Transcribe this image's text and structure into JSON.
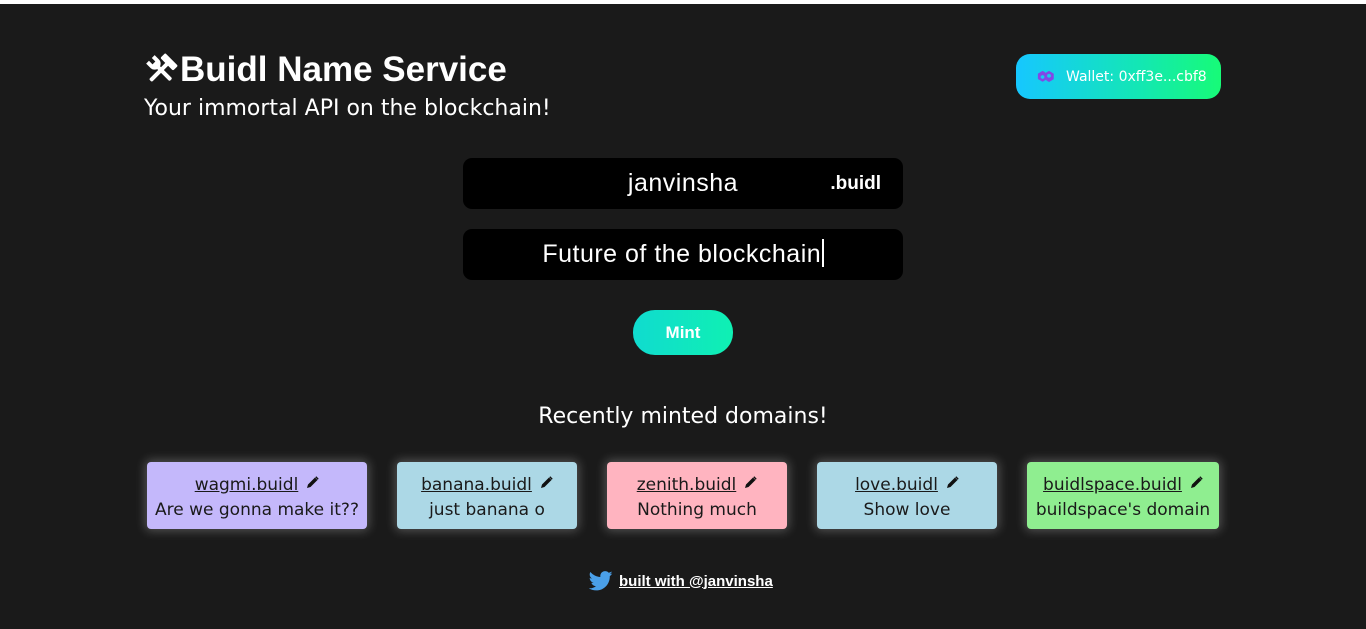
{
  "header": {
    "title": "Buidl Name Service",
    "subtitle": "Your immortal API on the blockchain!",
    "icon": "hammer-and-wrench-icon"
  },
  "wallet": {
    "label": "Wallet: 0xff3e...cbf8",
    "icon": "polygon-icon",
    "gradient": [
      "#16c7ff",
      "#17fb77"
    ]
  },
  "form": {
    "domain_value": "janvinsha",
    "tld": ".buidl",
    "record_value": "Future of the blockchain",
    "mint_label": "Mint"
  },
  "recent": {
    "title": "Recently minted domains!",
    "domains": [
      {
        "name": "wagmi.buidl",
        "record": "Are we gonna make it??",
        "color": "#c4b8fb"
      },
      {
        "name": "banana.buidl",
        "record": "just banana o",
        "color": "#acd8e6"
      },
      {
        "name": "zenith.buidl",
        "record": "Nothing much",
        "color": "#ffb4c0"
      },
      {
        "name": "love.buidl",
        "record": "Show love",
        "color": "#acd8e6"
      },
      {
        "name": "buidlspace.buidl",
        "record": "buildspace's domain",
        "color": "#8fee90"
      }
    ]
  },
  "footer": {
    "text": "built with @janvinsha",
    "icon": "twitter-icon"
  }
}
